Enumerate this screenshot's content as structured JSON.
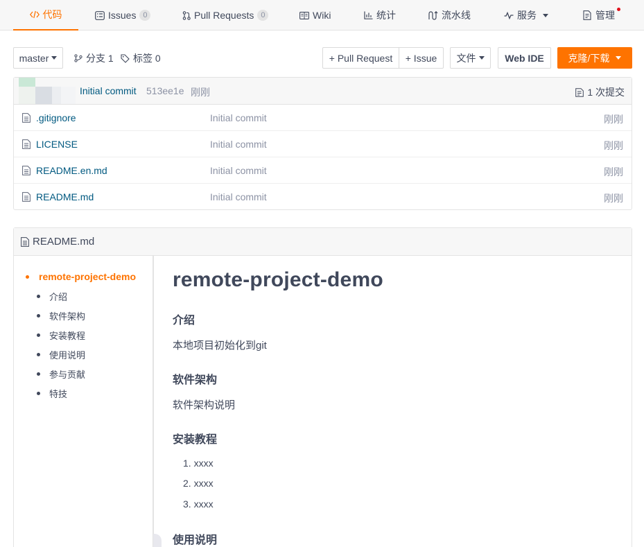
{
  "tabs": [
    {
      "label": "代码",
      "icon": "code-icon",
      "active": true
    },
    {
      "label": "Issues",
      "icon": "issues-icon",
      "count": "0"
    },
    {
      "label": "Pull Requests",
      "icon": "pull-request-icon",
      "count": "0"
    },
    {
      "label": "Wiki",
      "icon": "wiki-icon"
    },
    {
      "label": "统计",
      "icon": "stats-icon"
    },
    {
      "label": "流水线",
      "icon": "pipeline-icon"
    },
    {
      "label": "服务",
      "icon": "service-icon"
    },
    {
      "label": "管理",
      "icon": "manage-icon"
    }
  ],
  "toolbar": {
    "branch": "master",
    "branches": "分支 1",
    "tags": "标签 0",
    "pull_request": "+ Pull Request",
    "issue": "+ Issue",
    "file": "文件",
    "web_ide": "Web IDE",
    "clone": "克隆/下载"
  },
  "commit": {
    "message": "Initial commit",
    "hash": "513ee1e",
    "time": "刚刚",
    "count": "1 次提交"
  },
  "files": [
    {
      "name": ".gitignore",
      "message": "Initial commit",
      "time": "刚刚"
    },
    {
      "name": "LICENSE",
      "message": "Initial commit",
      "time": "刚刚"
    },
    {
      "name": "README.en.md",
      "message": "Initial commit",
      "time": "刚刚"
    },
    {
      "name": "README.md",
      "message": "Initial commit",
      "time": "刚刚"
    }
  ],
  "readme": {
    "filename": "README.md",
    "toc_main": "remote-project-demo",
    "toc": [
      "介绍",
      "软件架构",
      "安装教程",
      "使用说明",
      "参与贡献",
      "特技"
    ],
    "title": "remote-project-demo",
    "sections": {
      "intro_h": "介绍",
      "intro_p": "本地项目初始化到git",
      "arch_h": "软件架构",
      "arch_p": "软件架构说明",
      "install_h": "安装教程",
      "install_list": [
        "1. xxxx",
        "2. xxxx",
        "3. xxxx"
      ],
      "usage_h": "使用说明"
    }
  },
  "colors": {
    "accent": "#fe7300",
    "link": "#005980",
    "muted": "#8c92a4",
    "text": "#40485b"
  }
}
